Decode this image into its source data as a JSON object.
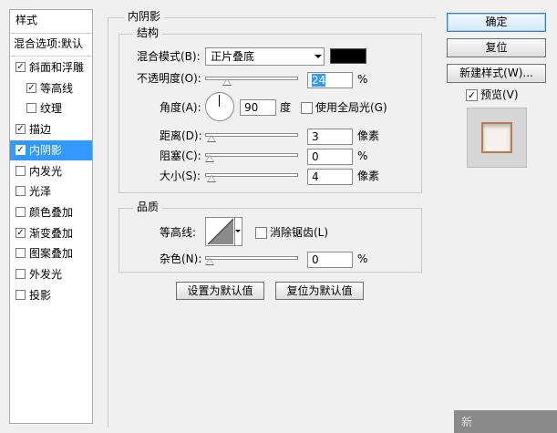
{
  "style_list": {
    "header": "样式",
    "blending_options": "混合选项:默认",
    "items": [
      {
        "label": "斜面和浮雕",
        "checked": true
      },
      {
        "label": "等高线",
        "checked": true
      },
      {
        "label": "纹理",
        "checked": false
      },
      {
        "label": "描边",
        "checked": true
      },
      {
        "label": "内阴影",
        "checked": true
      },
      {
        "label": "内发光",
        "checked": false
      },
      {
        "label": "光泽",
        "checked": false
      },
      {
        "label": "颜色叠加",
        "checked": false
      },
      {
        "label": "渐变叠加",
        "checked": true
      },
      {
        "label": "图案叠加",
        "checked": false
      },
      {
        "label": "外发光",
        "checked": false
      },
      {
        "label": "投影",
        "checked": false
      }
    ],
    "selected": "内阴影"
  },
  "panel": {
    "title": "内阴影",
    "structure": {
      "title": "结构",
      "blend_mode_label": "混合模式(B):",
      "blend_mode_value": "正片叠底",
      "shadow_color": "#000000",
      "opacity_label": "不透明度(O):",
      "opacity_value": "24",
      "opacity_unit": "%",
      "opacity_fraction": 0.24,
      "angle_label": "角度(A):",
      "angle_value": "90",
      "angle_unit": "度",
      "global_light_label": "使用全局光(G)",
      "global_light_checked": false,
      "distance_label": "距离(D):",
      "distance_value": "3",
      "distance_unit": "像素",
      "choke_label": "阻塞(C):",
      "choke_value": "0",
      "choke_unit": "%",
      "size_label": "大小(S):",
      "size_value": "4",
      "size_unit": "像素"
    },
    "quality": {
      "title": "品质",
      "contour_label": "等高线:",
      "anti_alias_label": "消除锯齿(L)",
      "anti_alias_checked": false,
      "noise_label": "杂色(N):",
      "noise_value": "0",
      "noise_unit": "%"
    },
    "make_default": "设置为默认值",
    "reset_default": "复位为默认值"
  },
  "buttons": {
    "ok": "确定",
    "reset": "复位",
    "new_style": "新建样式(W)...",
    "preview_label": "预览(V)",
    "preview_checked": true
  },
  "watermark": "新"
}
